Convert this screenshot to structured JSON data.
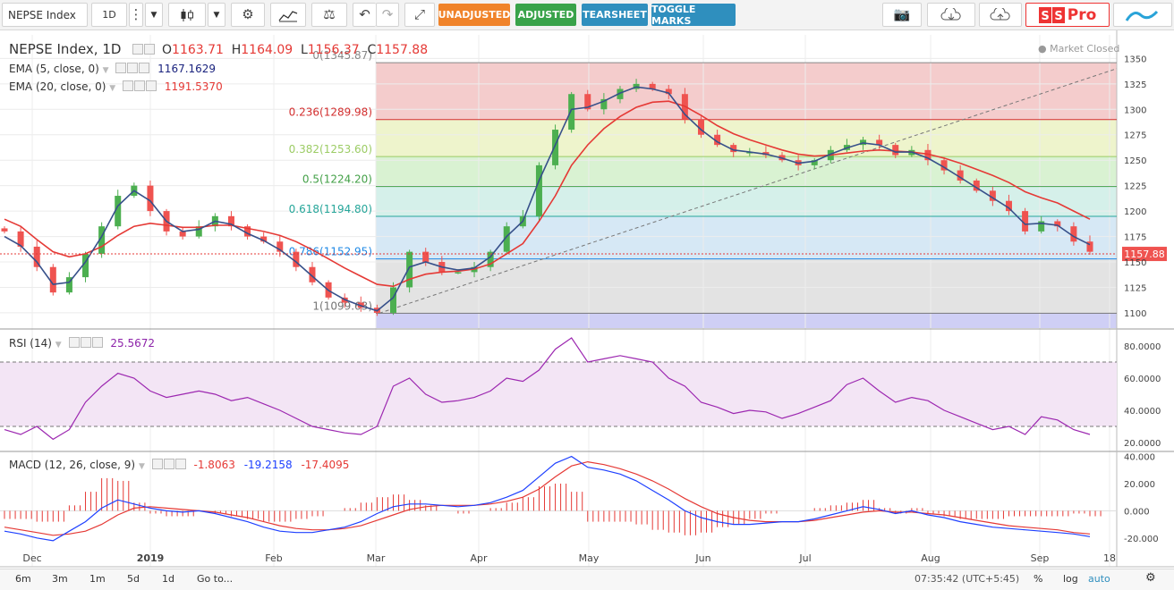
{
  "toolbar": {
    "symbol": "NEPSE Index",
    "interval": "1D",
    "btn_unadjusted": "UNADJUSTED",
    "btn_adjusted": "ADJUSTED",
    "btn_tearsheet": "TEARSHEET",
    "btn_toggle": "TOGGLE MARKS",
    "logo_text": "Pro",
    "icons": [
      "more-icon",
      "chevron-down-icon",
      "candles-icon",
      "chevron-down-icon",
      "gear-icon",
      "indicators-icon",
      "compare-icon",
      "undo-icon",
      "redo-icon",
      "fullscreen-icon",
      "camera-icon",
      "cloud-download-icon",
      "cloud-upload-icon",
      "logo-icon"
    ],
    "colors": {
      "unadjusted": "#f0832a",
      "adjusted": "#39a34a",
      "tearsheet": "#2f8fbe",
      "toggle": "#2f8fbe"
    }
  },
  "legend": {
    "title": "NEPSE Index, 1D",
    "o_label": "O",
    "o_value": "1163.71",
    "h_label": "H",
    "h_value": "1164.09",
    "l_label": "L",
    "l_value": "1156.37",
    "c_label": "C",
    "c_value": "1157.88",
    "ema5": {
      "label": "EMA (5, close, 0)",
      "value": "1167.1629",
      "color": "#1a237e"
    },
    "ema20": {
      "label": "EMA (20, close, 0)",
      "value": "1191.5370",
      "color": "#e53935"
    },
    "market_status": "Market Closed"
  },
  "rsi_legend": {
    "label": "RSI (14)",
    "value": "25.5672"
  },
  "macd_legend": {
    "label": "MACD (12, 26, close, 9)",
    "hist": "-1.8063",
    "macd": "-19.2158",
    "signal": "-17.4095"
  },
  "price_tag": "1157.88",
  "chart_data": [
    {
      "type": "candlestick",
      "name": "NEPSE Index",
      "ylim": [
        1085,
        1360
      ],
      "yticks": [
        1100,
        1125,
        1150,
        1175,
        1200,
        1225,
        1250,
        1275,
        1300,
        1325,
        1350
      ],
      "xticks": [
        "Dec",
        "2019",
        "Feb",
        "Mar",
        "Apr",
        "May",
        "Jun",
        "Jul",
        "Aug",
        "Sep",
        "18"
      ],
      "close_path": [
        1180,
        1165,
        1145,
        1120,
        1135,
        1158,
        1185,
        1215,
        1225,
        1200,
        1180,
        1175,
        1185,
        1195,
        1185,
        1175,
        1170,
        1160,
        1145,
        1130,
        1115,
        1110,
        1105,
        1100,
        1125,
        1160,
        1150,
        1140,
        1140,
        1145,
        1160,
        1185,
        1195,
        1245,
        1280,
        1315,
        1300,
        1310,
        1320,
        1325,
        1320,
        1315,
        1290,
        1275,
        1265,
        1258,
        1258,
        1255,
        1250,
        1245,
        1250,
        1260,
        1265,
        1270,
        1265,
        1255,
        1260,
        1250,
        1240,
        1230,
        1220,
        1210,
        1200,
        1180,
        1190,
        1185,
        1170,
        1160
      ],
      "ema5": [
        1175,
        1166,
        1150,
        1128,
        1130,
        1150,
        1175,
        1205,
        1220,
        1210,
        1190,
        1180,
        1182,
        1190,
        1187,
        1178,
        1171,
        1162,
        1150,
        1136,
        1122,
        1113,
        1107,
        1102,
        1115,
        1145,
        1150,
        1145,
        1142,
        1144,
        1155,
        1175,
        1190,
        1230,
        1265,
        1300,
        1302,
        1308,
        1316,
        1322,
        1320,
        1316,
        1295,
        1280,
        1268,
        1260,
        1258,
        1256,
        1252,
        1247,
        1249,
        1256,
        1262,
        1267,
        1265,
        1258,
        1258,
        1252,
        1243,
        1233,
        1223,
        1213,
        1203,
        1187,
        1188,
        1186,
        1175,
        1167
      ],
      "ema20": [
        1192,
        1185,
        1172,
        1160,
        1155,
        1158,
        1165,
        1176,
        1185,
        1188,
        1186,
        1184,
        1184,
        1186,
        1186,
        1183,
        1180,
        1176,
        1170,
        1162,
        1153,
        1144,
        1136,
        1128,
        1126,
        1133,
        1138,
        1140,
        1141,
        1143,
        1148,
        1158,
        1168,
        1190,
        1215,
        1245,
        1265,
        1281,
        1293,
        1302,
        1307,
        1308,
        1303,
        1294,
        1284,
        1276,
        1270,
        1265,
        1260,
        1256,
        1254,
        1255,
        1257,
        1259,
        1260,
        1259,
        1258,
        1256,
        1252,
        1247,
        1241,
        1235,
        1228,
        1219,
        1213,
        1208,
        1200,
        1192
      ],
      "last_close": 1157.88,
      "fibonacci": [
        {
          "ratio": "0",
          "price": 1345.87,
          "label": "0(1345.87)",
          "color": "#888888",
          "fill": "#f4cccc"
        },
        {
          "ratio": "0.236",
          "price": 1289.98,
          "label": "0.236(1289.98)",
          "color": "#d32f2f",
          "fill": "#eef4cc"
        },
        {
          "ratio": "0.382",
          "price": 1253.6,
          "label": "0.382(1253.60)",
          "color": "#9ccc65",
          "fill": "#d9f2d2"
        },
        {
          "ratio": "0.5",
          "price": 1224.2,
          "label": "0.5(1224.20)",
          "color": "#43a047",
          "fill": "#d5f0ea"
        },
        {
          "ratio": "0.618",
          "price": 1194.8,
          "label": "0.618(1194.80)",
          "color": "#26a69a",
          "fill": "#d6e8f5"
        },
        {
          "ratio": "0.786",
          "price": 1152.95,
          "label": "0.786(1152.95)",
          "color": "#1e88e5",
          "fill": "#e3e3e3"
        },
        {
          "ratio": "1",
          "price": 1099.63,
          "label": "1(1099.63)",
          "color": "#757575",
          "fill": "#cfcff5"
        }
      ],
      "trendline": {
        "from": [
          1099.63,
          "Mar"
        ],
        "to": [
          1340,
          "18"
        ]
      }
    },
    {
      "type": "line",
      "name": "RSI (14)",
      "ylim": [
        15,
        90
      ],
      "yticks": [
        20,
        40,
        60,
        80
      ],
      "bands": [
        30,
        70
      ],
      "values": [
        28,
        25,
        30,
        22,
        28,
        45,
        55,
        63,
        60,
        52,
        48,
        50,
        52,
        50,
        46,
        48,
        44,
        40,
        35,
        30,
        28,
        26,
        25,
        30,
        55,
        60,
        50,
        45,
        46,
        48,
        52,
        60,
        58,
        65,
        78,
        85,
        70,
        72,
        74,
        72,
        70,
        60,
        55,
        45,
        42,
        38,
        40,
        39,
        35,
        38,
        42,
        46,
        56,
        60,
        52,
        45,
        48,
        46,
        40,
        36,
        32,
        28,
        30,
        25,
        36,
        34,
        28,
        25
      ]
    },
    {
      "type": "macd",
      "name": "MACD (12, 26, close, 9)",
      "ylim": [
        -28,
        43
      ],
      "yticks": [
        -20,
        0,
        20,
        40
      ],
      "macd": [
        -15,
        -17,
        -20,
        -22,
        -15,
        -8,
        2,
        8,
        5,
        2,
        0,
        -1,
        0,
        -2,
        -5,
        -8,
        -12,
        -15,
        -16,
        -16,
        -14,
        -12,
        -8,
        -2,
        3,
        5,
        5,
        4,
        3,
        4,
        6,
        10,
        15,
        25,
        35,
        40,
        32,
        30,
        27,
        22,
        15,
        8,
        0,
        -5,
        -8,
        -10,
        -10,
        -9,
        -8,
        -8,
        -6,
        -3,
        0,
        3,
        1,
        -2,
        0,
        -3,
        -5,
        -8,
        -10,
        -12,
        -13,
        -14,
        -15,
        -16,
        -17,
        -19
      ],
      "signal": [
        -12,
        -14,
        -16,
        -18,
        -17,
        -15,
        -10,
        -3,
        2,
        3,
        2,
        1,
        0,
        -1,
        -3,
        -5,
        -8,
        -11,
        -13,
        -14,
        -14,
        -13,
        -11,
        -7,
        -3,
        1,
        3,
        4,
        4,
        4,
        5,
        7,
        10,
        16,
        25,
        33,
        36,
        34,
        31,
        27,
        22,
        16,
        9,
        3,
        -2,
        -5,
        -7,
        -8,
        -8,
        -8,
        -7,
        -5,
        -3,
        -1,
        0,
        -1,
        -1,
        -2,
        -3,
        -5,
        -7,
        -9,
        -11,
        -12,
        -13,
        -14,
        -16,
        -17
      ]
    }
  ],
  "bottombar": {
    "ranges": [
      "6m",
      "3m",
      "1m",
      "5d",
      "1d"
    ],
    "goto": "Go to...",
    "time": "07:35:42 (UTC+5:45)",
    "pct": "%",
    "log": "log",
    "auto": "auto"
  }
}
